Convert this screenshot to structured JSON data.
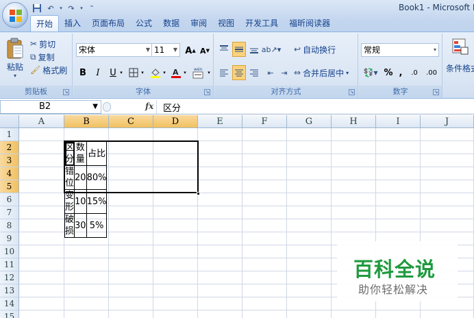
{
  "window": {
    "title": "Book1 - Microsoft E"
  },
  "tabs": [
    "开始",
    "插入",
    "页面布局",
    "公式",
    "数据",
    "审阅",
    "视图",
    "开发工具",
    "福昕阅读器"
  ],
  "active_tab": "开始",
  "ribbon": {
    "clipboard": {
      "paste": "粘贴",
      "cut": "剪切",
      "copy": "复制",
      "format_painter": "格式刷",
      "label": "剪贴板"
    },
    "font": {
      "name": "宋体",
      "size": "11",
      "bold": "B",
      "italic": "I",
      "underline": "U",
      "grow": "A",
      "shrink": "A",
      "phonetic": "wén",
      "label": "字体"
    },
    "alignment": {
      "wrap_text": "自动换行",
      "merge_center": "合并后居中",
      "label": "对齐方式"
    },
    "number": {
      "format": "常规",
      "percent": "%",
      "comma": ",",
      "inc_decimal": ".0",
      "dec_decimal": ".00",
      "label": "数字"
    },
    "styles": {
      "conditional": "条件格式"
    }
  },
  "namebox": {
    "value": "B2"
  },
  "formula": {
    "fx": "fx",
    "content": "区分"
  },
  "columns": [
    "A",
    "B",
    "C",
    "D",
    "E",
    "F",
    "G",
    "H",
    "I",
    "J"
  ],
  "rows": [
    "1",
    "2",
    "3",
    "4",
    "5",
    "6",
    "7",
    "8",
    "9",
    "10",
    "11",
    "12",
    "13",
    "14",
    "15"
  ],
  "table": {
    "headers": [
      "区分",
      "数量",
      "占比"
    ],
    "rows": [
      [
        "错位",
        "20",
        "80%"
      ],
      [
        "变形",
        "10",
        "15%"
      ],
      [
        "破损",
        "30",
        "5%"
      ]
    ]
  },
  "watermark": {
    "title": "百科全说",
    "subtitle": "助你轻松解决"
  },
  "colors": {
    "accent": "#15428b",
    "selected_header": "#f1c15f",
    "watermark": "#1f9a3e"
  }
}
